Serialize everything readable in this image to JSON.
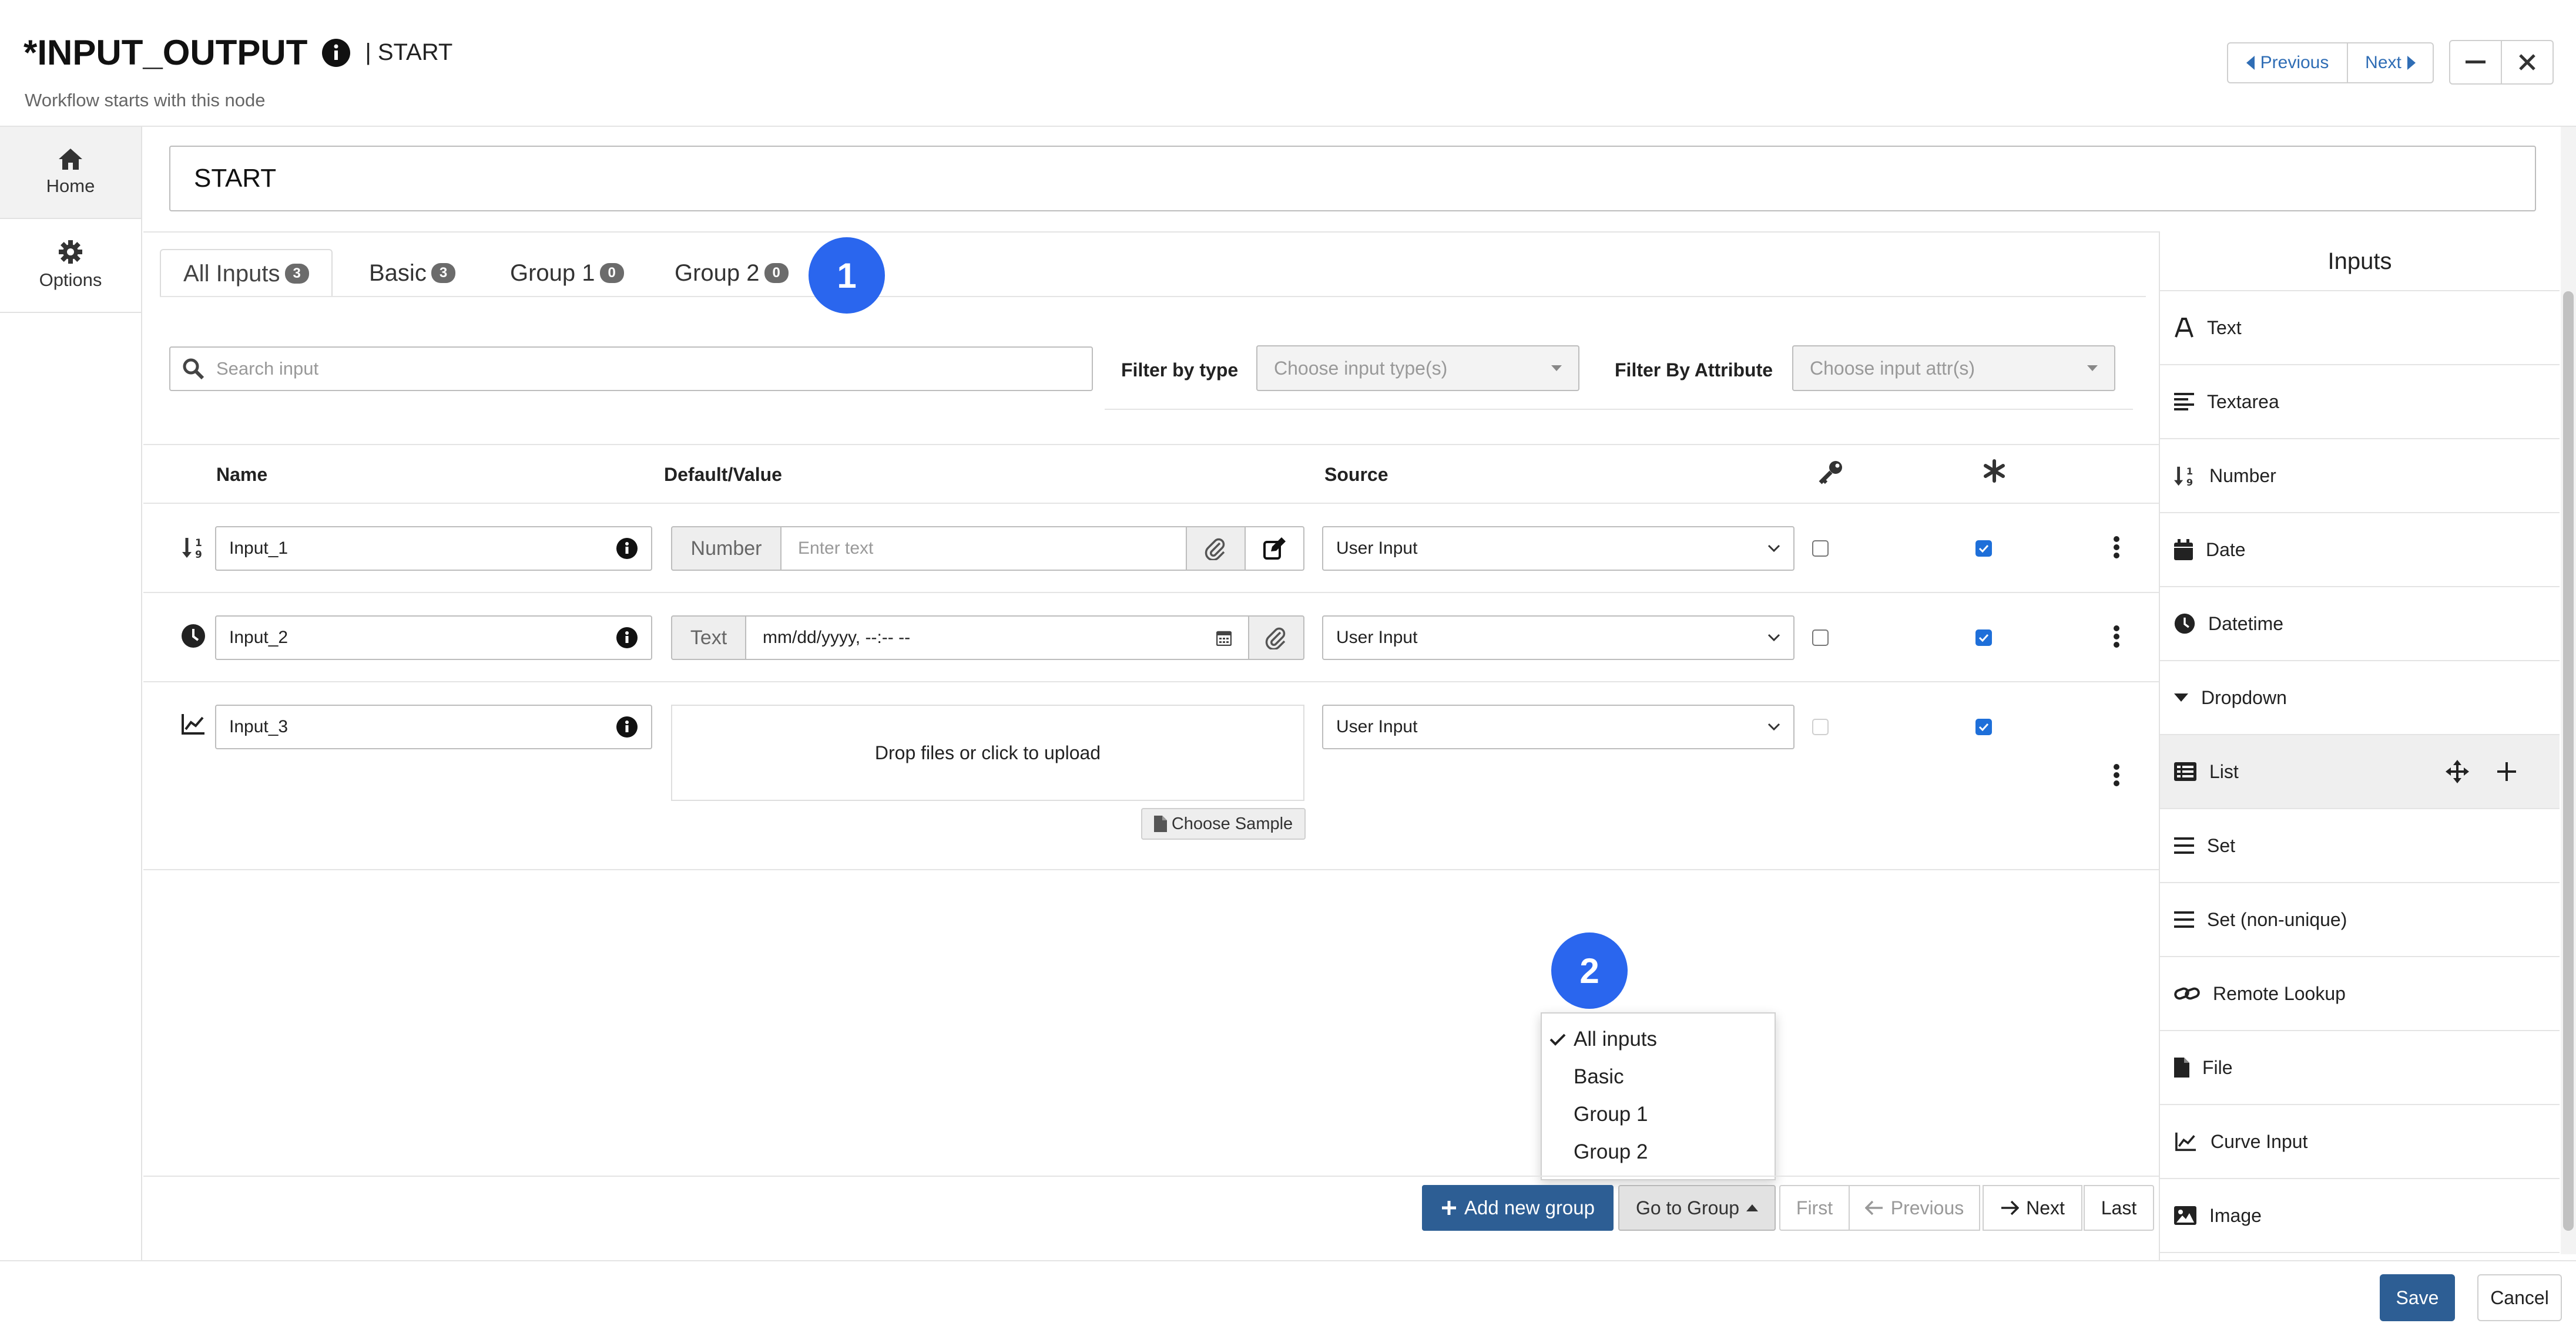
{
  "header": {
    "title": "*INPUT_OUTPUT",
    "node": "| START",
    "subtitle": "Workflow starts with this node",
    "prev_label": "Previous",
    "next_label": "Next",
    "minimize": "–",
    "close": "✕"
  },
  "sidebar": {
    "items": [
      {
        "label": "Home",
        "icon": "home-icon"
      },
      {
        "label": "Options",
        "icon": "gear-icon"
      }
    ]
  },
  "node_name": "START",
  "tabs": [
    {
      "label": "All Inputs",
      "count": "3"
    },
    {
      "label": "Basic",
      "count": "3"
    },
    {
      "label": "Group 1",
      "count": "0"
    },
    {
      "label": "Group 2",
      "count": "0"
    }
  ],
  "markers": {
    "one": "1",
    "two": "2"
  },
  "search": {
    "placeholder": "Search input"
  },
  "filters": {
    "type_label": "Filter by type",
    "type_placeholder": "Choose input type(s)",
    "attr_label": "Filter By Attribute",
    "attr_placeholder": "Choose input attr(s)"
  },
  "table": {
    "headers": {
      "name": "Name",
      "value": "Default/Value",
      "source": "Source"
    },
    "rows": [
      {
        "icon": "sort-numeric-icon",
        "name": "Input_1",
        "type": "Number",
        "value_placeholder": "Enter text",
        "source": "User Input",
        "key": false,
        "required": true
      },
      {
        "icon": "clock-icon",
        "name": "Input_2",
        "type": "Text",
        "value": "mm/dd/yyyy, --:-- --",
        "source": "User Input",
        "key": false,
        "required": true
      },
      {
        "icon": "chart-line-icon",
        "name": "Input_3",
        "upload": "Drop files or click to upload",
        "sample": "Choose Sample",
        "source": "User Input",
        "key": false,
        "required": true
      }
    ]
  },
  "group_menu": {
    "items": [
      "All inputs",
      "Basic",
      "Group 1",
      "Group 2"
    ],
    "selected": "All inputs"
  },
  "pager": {
    "add_group": "Add new group",
    "goto_group": "Go to Group",
    "first": "First",
    "previous": "Previous",
    "next": "Next",
    "last": "Last"
  },
  "palette": {
    "title": "Inputs",
    "items": [
      {
        "label": "Text",
        "icon": "font-icon"
      },
      {
        "label": "Textarea",
        "icon": "align-left-icon"
      },
      {
        "label": "Number",
        "icon": "sort-numeric-icon"
      },
      {
        "label": "Date",
        "icon": "calendar-icon"
      },
      {
        "label": "Datetime",
        "icon": "clock-icon"
      },
      {
        "label": "Dropdown",
        "icon": "caret-down-icon"
      },
      {
        "label": "List",
        "icon": "list-icon"
      },
      {
        "label": "Set",
        "icon": "bars-icon"
      },
      {
        "label": "Set (non-unique)",
        "icon": "bars-icon"
      },
      {
        "label": "Remote Lookup",
        "icon": "link-icon"
      },
      {
        "label": "File",
        "icon": "file-icon"
      },
      {
        "label": "Curve Input",
        "icon": "chart-line-icon"
      },
      {
        "label": "Image",
        "icon": "image-icon"
      }
    ]
  },
  "footer": {
    "save": "Save",
    "cancel": "Cancel"
  },
  "colors": {
    "accent": "#2a66ee",
    "primary_btn": "#2d5e94",
    "checkbox": "#1e6fd9",
    "link": "#2f6db5"
  }
}
